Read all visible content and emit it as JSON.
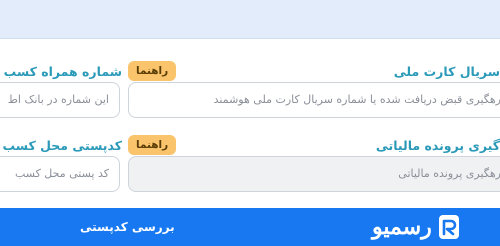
{
  "form": {
    "business_phone": {
      "label": "شماره همراه کسب و ک",
      "guide": "راهنما",
      "placeholder": "این شماره در بانک اط"
    },
    "national_card_serial": {
      "label": "سریال کارت ملی",
      "placeholder": "رهگیری قبض دریافت شده یا شماره سریال کارت  ملی هوشمند"
    },
    "business_postal_code": {
      "label": "کدپستی محل کسب و",
      "guide": "راهنما",
      "placeholder": "کد پستی محل کسب"
    },
    "tax_file_tracking": {
      "label": "گیری پرونده مالیاتی",
      "placeholder": "رهگیری پرونده مالیاتی"
    }
  },
  "footer": {
    "postal_check_label": "بررسی کدپستی",
    "brand_name": "رسمیو",
    "brand_color": "#1778f2"
  }
}
